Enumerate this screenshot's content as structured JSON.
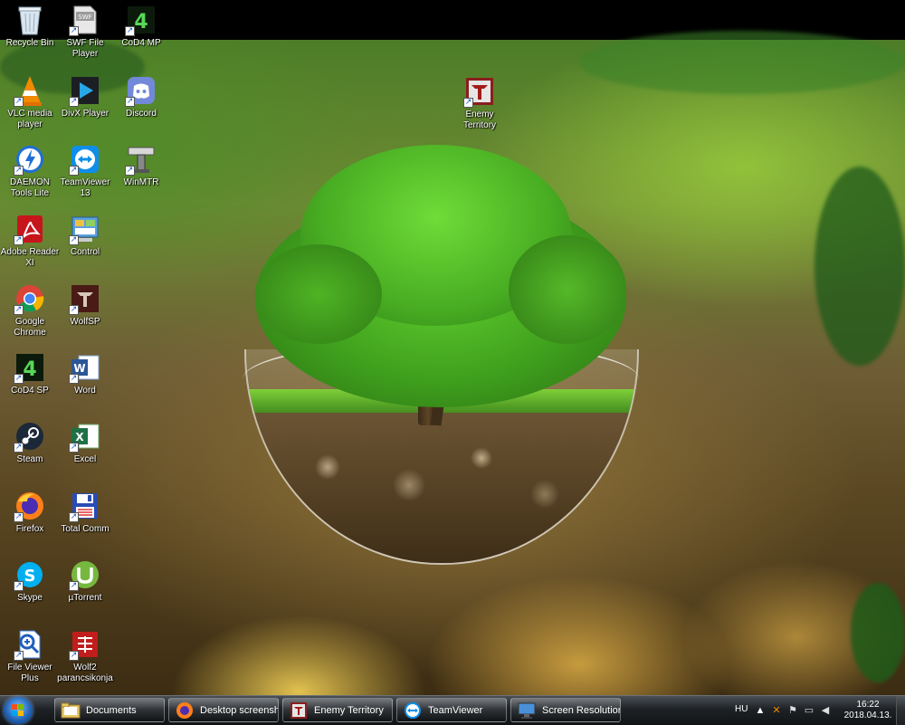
{
  "desktop": {
    "icons": [
      {
        "label": "Recycle Bin",
        "icon": "recycle-bin-icon"
      },
      {
        "label": "SWF File Player",
        "icon": "swf-icon"
      },
      {
        "label": "CoD4 MP",
        "icon": "cod4-icon"
      },
      {
        "label": "VLC media player",
        "icon": "vlc-icon"
      },
      {
        "label": "DivX Player",
        "icon": "divx-icon"
      },
      {
        "label": "Discord",
        "icon": "discord-icon"
      },
      {
        "label": "DAEMON Tools Lite",
        "icon": "daemon-tools-icon"
      },
      {
        "label": "TeamViewer 13",
        "icon": "teamviewer-icon"
      },
      {
        "label": "WinMTR",
        "icon": "winmtr-icon"
      },
      {
        "label": "Adobe Reader XI",
        "icon": "adobe-reader-icon"
      },
      {
        "label": "Control",
        "icon": "control-panel-icon"
      },
      {
        "label": "Google Chrome",
        "icon": "chrome-icon"
      },
      {
        "label": "WolfSP",
        "icon": "wolfsp-icon"
      },
      {
        "label": "CoD4 SP",
        "icon": "cod4-icon"
      },
      {
        "label": "Word",
        "icon": "word-icon"
      },
      {
        "label": "Steam",
        "icon": "steam-icon"
      },
      {
        "label": "Excel",
        "icon": "excel-icon"
      },
      {
        "label": "Firefox",
        "icon": "firefox-icon"
      },
      {
        "label": "Total Comm",
        "icon": "total-commander-icon"
      },
      {
        "label": "Skype",
        "icon": "skype-icon"
      },
      {
        "label": "µTorrent",
        "icon": "utorrent-icon"
      },
      {
        "label": "File Viewer Plus",
        "icon": "file-viewer-icon"
      },
      {
        "label": "Wolf2 parancsikonja",
        "icon": "wolf2-icon"
      },
      {
        "label": "Enemy Territory",
        "icon": "enemy-territory-icon"
      }
    ]
  },
  "taskbar": {
    "buttons": [
      {
        "label": "Documents",
        "icon": "folder-icon"
      },
      {
        "label": "Desktop screensh...",
        "icon": "firefox-icon"
      },
      {
        "label": "Enemy Territory",
        "icon": "enemy-territory-icon"
      },
      {
        "label": "TeamViewer",
        "icon": "teamviewer-icon"
      },
      {
        "label": "Screen Resolution",
        "icon": "monitor-icon"
      }
    ],
    "tray": {
      "language": "HU",
      "time": "16:22",
      "date": "2018.04.13."
    }
  }
}
